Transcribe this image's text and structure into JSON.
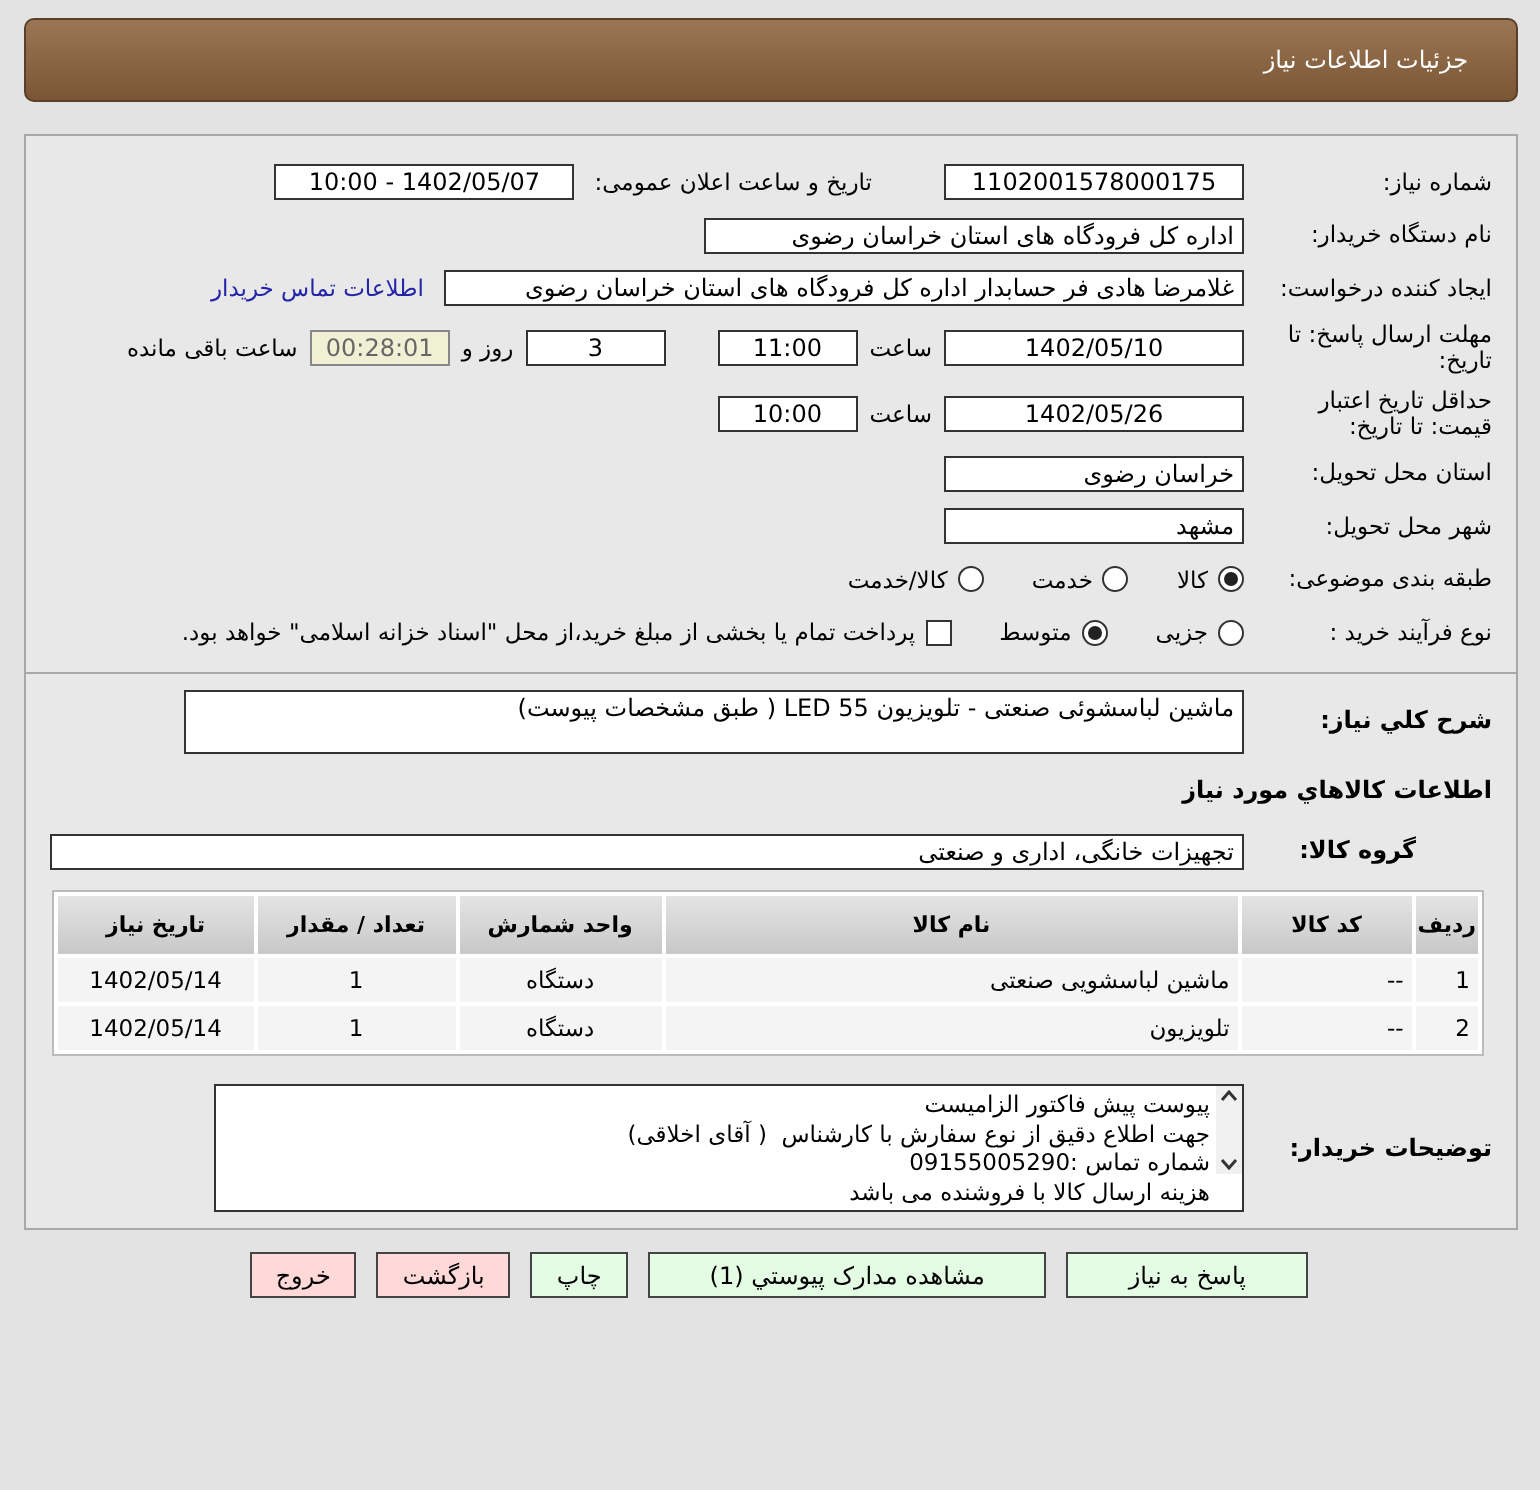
{
  "header": {
    "title": "جزئیات اطلاعات نیاز"
  },
  "need_number": {
    "label": "شماره نیاز:",
    "value": "1102001578000175"
  },
  "announce": {
    "label": "تاریخ و ساعت اعلان عمومی:",
    "value": "1402/05/07 - 10:00"
  },
  "buyer_org": {
    "label": "نام دستگاه خریدار:",
    "value": "اداره کل فرودگاه های استان خراسان رضوی"
  },
  "requester": {
    "label": "ایجاد کننده درخواست:",
    "value": "غلامرضا هادی فر حسابدار اداره کل فرودگاه های استان خراسان رضوی",
    "link": "اطلاعات تماس خریدار"
  },
  "reply_deadline": {
    "label": "مهلت ارسال پاسخ: تا تاریخ:",
    "date": "1402/05/10",
    "time_label": "ساعت",
    "time": "11:00",
    "days": "3",
    "days_label": "روز و",
    "remaining": "00:28:01",
    "remaining_label": "ساعت باقی مانده"
  },
  "price_validity": {
    "label": "حداقل تاریخ اعتبار قیمت: تا تاریخ:",
    "date": "1402/05/26",
    "time_label": "ساعت",
    "time": "10:00"
  },
  "province": {
    "label": "استان محل تحویل:",
    "value": "خراسان رضوی"
  },
  "city": {
    "label": "شهر محل تحویل:",
    "value": "مشهد"
  },
  "category": {
    "label": "طبقه بندی موضوعی:",
    "options": [
      {
        "label": "کالا",
        "selected": true
      },
      {
        "label": "خدمت",
        "selected": false
      },
      {
        "label": "کالا/خدمت",
        "selected": false
      }
    ]
  },
  "process": {
    "label": "نوع فرآیند خرید :",
    "options": [
      {
        "label": "جزیی",
        "selected": false
      },
      {
        "label": "متوسط",
        "selected": true
      }
    ],
    "payment": {
      "label": "پرداخت تمام یا بخشی از مبلغ خرید،از محل \"اسناد خزانه اسلامی\" خواهد بود.",
      "checked": false
    }
  },
  "description": {
    "label": "شرح کلي نياز:",
    "value": "ماشین لباسشوئی صنعتی - تلویزیون LED 55 ( طبق مشخصات پیوست)"
  },
  "goods_heading": "اطلاعات کالاهاي مورد نياز",
  "goods_group": {
    "label": "گروه کالا:",
    "value": "تجهیزات خانگی، اداری و صنعتی"
  },
  "table": {
    "columns": [
      "ردیف",
      "کد کالا",
      "نام کالا",
      "واحد شمارش",
      "تعداد / مقدار",
      "تاریخ نیاز"
    ],
    "rows": [
      [
        "1",
        "--",
        "ماشین لباسشویی صنعتی",
        "دستگاه",
        "1",
        "1402/05/14"
      ],
      [
        "2",
        "--",
        "تلویزیون",
        "دستگاه",
        "1",
        "1402/05/14"
      ]
    ]
  },
  "buyer_notes": {
    "label": "توضیحات خریدار:",
    "lines": [
      "پیوست پیش فاکتور الزامیست",
      "جهت اطلاع دقیق از نوع سفارش با کارشناس  ( آقای اخلاقی)",
      "شماره تماس :09155005290",
      "هزینه ارسال کالا با فروشنده می باشد"
    ]
  },
  "buttons": [
    {
      "label": "پاسخ به نیاز",
      "kind": "normal"
    },
    {
      "label": "مشاهده مدارک پیوستي (1)",
      "kind": "normal"
    },
    {
      "label": "چاپ",
      "kind": "normal"
    },
    {
      "label": "بازگشت",
      "kind": "danger"
    },
    {
      "label": "خروج",
      "kind": "danger"
    }
  ]
}
